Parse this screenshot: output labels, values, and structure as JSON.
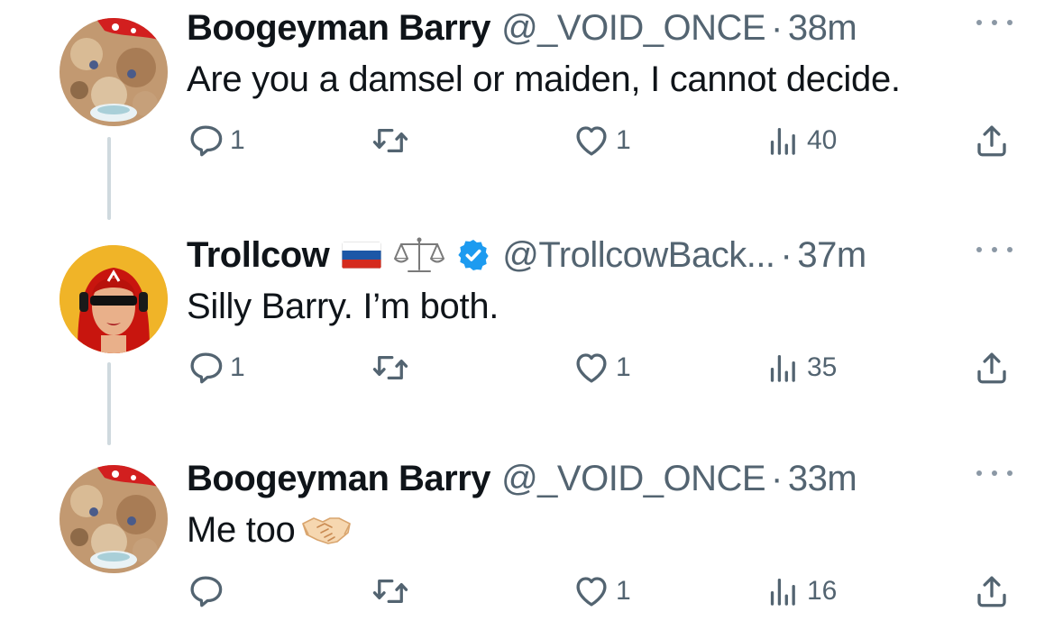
{
  "colors": {
    "text": "#0f1419",
    "secondary": "#536471",
    "thread_line": "#cfd9de",
    "verified": "#1d9bf0"
  },
  "tweets": [
    {
      "name": "Boogeyman Barry",
      "handle": "@_VOID_ONCE",
      "separator": "·",
      "time": "38m",
      "text": "Are you a damsel or maiden, I cannot decide.",
      "replies": "1",
      "retweets": "",
      "likes": "1",
      "views": "40"
    },
    {
      "name": "Trollcow",
      "badges": [
        "russia-flag-icon",
        "balance-scale-icon",
        "verified-badge-icon"
      ],
      "handle": "@TrollcowBack...",
      "separator": "·",
      "time": "37m",
      "text": "Silly Barry. I’m both.",
      "replies": "1",
      "retweets": "",
      "likes": "1",
      "views": "35"
    },
    {
      "name": "Boogeyman Barry",
      "handle": "@_VOID_ONCE",
      "separator": "·",
      "time": "33m",
      "text": "Me too",
      "text_emoji": "handshake-icon",
      "replies": "",
      "retweets": "",
      "likes": "1",
      "views": "16"
    }
  ]
}
